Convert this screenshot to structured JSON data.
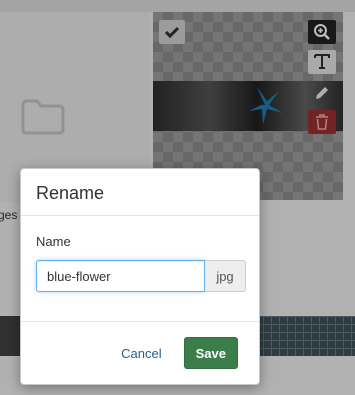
{
  "background": {
    "folder_label": "ges",
    "icons": {
      "folder": "folder-icon",
      "select": "check-icon",
      "preview": "zoom-in-icon",
      "rename": "text-icon",
      "edit": "pencil-icon",
      "delete": "trash-icon"
    }
  },
  "dialog": {
    "title": "Rename",
    "field_label": "Name",
    "name_value": "blue-flower",
    "extension": "jpg",
    "cancel_label": "Cancel",
    "save_label": "Save"
  },
  "colors": {
    "save_button": "#3c7e4a",
    "cancel_link": "#245e8e",
    "input_focus_border": "#66afe9",
    "delete_button": "#8c2d2d"
  }
}
